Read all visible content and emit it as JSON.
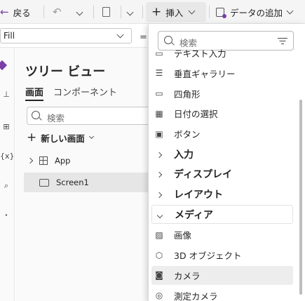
{
  "toolbar": {
    "back_label": "戻る",
    "insert_label": "挿入",
    "add_data_label": "データの追加"
  },
  "formula_bar": {
    "property_value": "Fill"
  },
  "tree_view": {
    "title": "ツリー ビュー",
    "tabs": [
      "画面",
      "コンポーネント"
    ],
    "search_placeholder": "検索",
    "new_screen_label": "新しい画面",
    "nodes": [
      "App",
      "Screen1"
    ]
  },
  "insert_menu": {
    "search_placeholder": "検索",
    "items": [
      {
        "label": "テキスト入力",
        "type": "item",
        "icon": "text-input-icon"
      },
      {
        "label": "垂直ギャラリー",
        "type": "item",
        "icon": "gallery-icon"
      },
      {
        "label": "四角形",
        "type": "item",
        "icon": "rectangle-icon"
      },
      {
        "label": "日付の選択",
        "type": "item",
        "icon": "calendar-icon"
      },
      {
        "label": "ボタン",
        "type": "item",
        "icon": "button-icon"
      },
      {
        "label": "入力",
        "type": "category",
        "icon": "chevron-right-icon"
      },
      {
        "label": "ディスプレイ",
        "type": "category",
        "icon": "chevron-right-icon"
      },
      {
        "label": "レイアウト",
        "type": "category",
        "icon": "chevron-right-icon"
      },
      {
        "label": "メディア",
        "type": "category-expanded",
        "icon": "chevron-down-icon"
      },
      {
        "label": "画像",
        "type": "item",
        "icon": "image-icon"
      },
      {
        "label": "3D オブジェクト",
        "type": "item",
        "icon": "cube-icon"
      },
      {
        "label": "カメラ",
        "type": "item-selected",
        "icon": "camera-icon"
      },
      {
        "label": "測定カメラ",
        "type": "item",
        "icon": "measure-camera-icon"
      }
    ]
  }
}
